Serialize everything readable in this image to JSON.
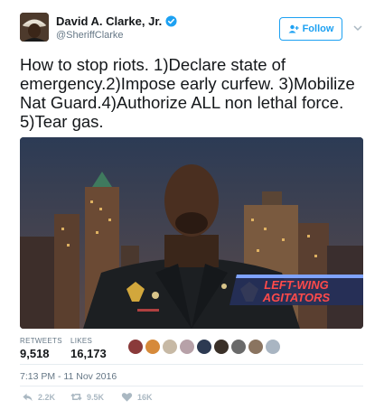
{
  "account": {
    "display_name": "David A. Clarke, Jr.",
    "handle": "@SheriffClarke",
    "verified": true,
    "avatar_icon": "profile-photo"
  },
  "follow_button": {
    "label": "Follow",
    "icon": "add-user-icon",
    "color": "#1da1f2"
  },
  "menu_icon": "chevron-down-icon",
  "tweet": {
    "text_lines": [
      "How to stop riots. 1)Declare state of",
      "emergency.2)Impose early curfew. 3)Mobilize",
      "Nat Guard.4)Authorize ALL non lethal force.",
      "5)Tear gas."
    ]
  },
  "media": {
    "description_icon": "video-frame",
    "chyron_line1": "LEFT-WING",
    "chyron_line2": "AGITATORS"
  },
  "stats": {
    "retweets_label": "RETWEETS",
    "retweets_value": "9,518",
    "likes_label": "LIKES",
    "likes_value": "16,173"
  },
  "likers_count_shown": 9,
  "timestamp": "7:13 PM - 11 Nov 2016",
  "actions": {
    "reply_count": "2.2K",
    "retweet_count": "9.5K",
    "like_count": "16K"
  }
}
